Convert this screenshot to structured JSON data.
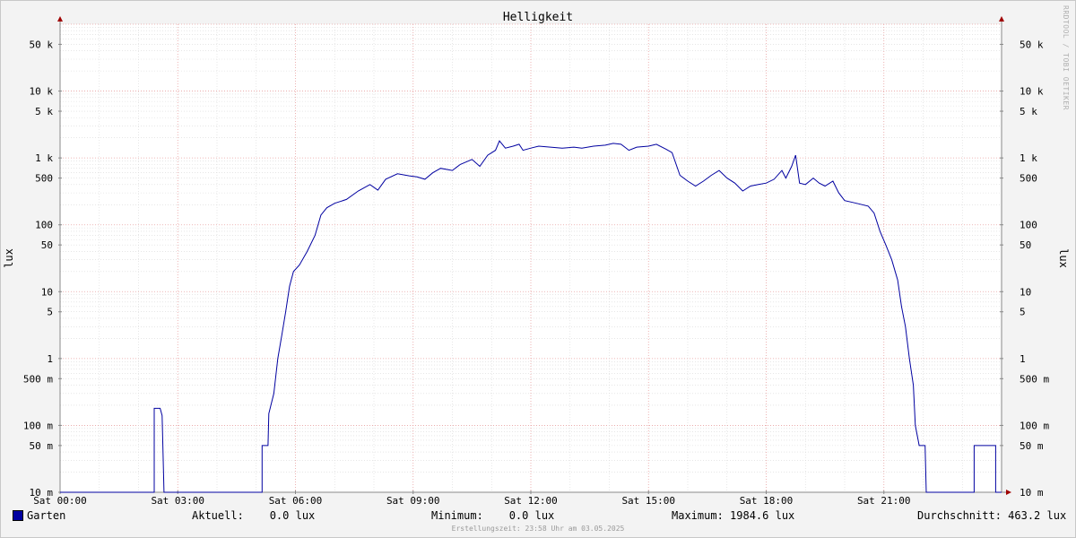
{
  "watermark": "RRDTOOL / TOBI OETIKER",
  "chart_data": {
    "type": "line",
    "title": "Helligkeit",
    "ylabel": "lux",
    "yscale": "log",
    "ylim": [
      0.01,
      100000
    ],
    "xlim_hours": [
      0,
      24
    ],
    "grid": true,
    "x_ticks": [
      {
        "hour": 0,
        "label": "Sat 00:00"
      },
      {
        "hour": 3,
        "label": "Sat 03:00"
      },
      {
        "hour": 6,
        "label": "Sat 06:00"
      },
      {
        "hour": 9,
        "label": "Sat 09:00"
      },
      {
        "hour": 12,
        "label": "Sat 12:00"
      },
      {
        "hour": 15,
        "label": "Sat 15:00"
      },
      {
        "hour": 18,
        "label": "Sat 18:00"
      },
      {
        "hour": 21,
        "label": "Sat 21:00"
      }
    ],
    "y_ticks": [
      {
        "value": 0.01,
        "label": "10 m"
      },
      {
        "value": 0.05,
        "label": "50 m"
      },
      {
        "value": 0.1,
        "label": "100 m"
      },
      {
        "value": 0.5,
        "label": "500 m"
      },
      {
        "value": 1,
        "label": "1"
      },
      {
        "value": 5,
        "label": "5"
      },
      {
        "value": 10,
        "label": "10"
      },
      {
        "value": 50,
        "label": "50"
      },
      {
        "value": 100,
        "label": "100"
      },
      {
        "value": 500,
        "label": "500"
      },
      {
        "value": 1000,
        "label": "1 k"
      },
      {
        "value": 5000,
        "label": "5 k"
      },
      {
        "value": 10000,
        "label": "10 k"
      },
      {
        "value": 50000,
        "label": "50 k"
      }
    ],
    "series": [
      {
        "name": "Garten",
        "color": "#0000a0",
        "points": [
          [
            0.0,
            0.01
          ],
          [
            2.4,
            0.01
          ],
          [
            2.4,
            0.18
          ],
          [
            2.55,
            0.18
          ],
          [
            2.6,
            0.14
          ],
          [
            2.65,
            0.01
          ],
          [
            5.15,
            0.01
          ],
          [
            5.15,
            0.05
          ],
          [
            5.3,
            0.05
          ],
          [
            5.32,
            0.15
          ],
          [
            5.45,
            0.3
          ],
          [
            5.55,
            1.0
          ],
          [
            5.65,
            2.2
          ],
          [
            5.75,
            5.0
          ],
          [
            5.85,
            12
          ],
          [
            5.95,
            20
          ],
          [
            6.1,
            25
          ],
          [
            6.3,
            40
          ],
          [
            6.5,
            70
          ],
          [
            6.65,
            140
          ],
          [
            6.8,
            180
          ],
          [
            7.0,
            210
          ],
          [
            7.3,
            240
          ],
          [
            7.6,
            320
          ],
          [
            7.9,
            400
          ],
          [
            8.1,
            330
          ],
          [
            8.3,
            480
          ],
          [
            8.6,
            580
          ],
          [
            8.9,
            540
          ],
          [
            9.1,
            520
          ],
          [
            9.3,
            480
          ],
          [
            9.5,
            600
          ],
          [
            9.7,
            700
          ],
          [
            10.0,
            650
          ],
          [
            10.2,
            800
          ],
          [
            10.5,
            950
          ],
          [
            10.7,
            750
          ],
          [
            10.9,
            1100
          ],
          [
            11.1,
            1300
          ],
          [
            11.2,
            1800
          ],
          [
            11.35,
            1400
          ],
          [
            11.55,
            1500
          ],
          [
            11.7,
            1600
          ],
          [
            11.8,
            1300
          ],
          [
            12.0,
            1400
          ],
          [
            12.2,
            1500
          ],
          [
            12.5,
            1450
          ],
          [
            12.8,
            1400
          ],
          [
            13.1,
            1450
          ],
          [
            13.3,
            1400
          ],
          [
            13.6,
            1500
          ],
          [
            13.9,
            1550
          ],
          [
            14.1,
            1650
          ],
          [
            14.3,
            1600
          ],
          [
            14.5,
            1300
          ],
          [
            14.7,
            1450
          ],
          [
            15.0,
            1500
          ],
          [
            15.2,
            1600
          ],
          [
            15.45,
            1350
          ],
          [
            15.6,
            1200
          ],
          [
            15.8,
            550
          ],
          [
            16.0,
            450
          ],
          [
            16.2,
            380
          ],
          [
            16.4,
            450
          ],
          [
            16.6,
            550
          ],
          [
            16.8,
            650
          ],
          [
            17.0,
            500
          ],
          [
            17.2,
            420
          ],
          [
            17.4,
            320
          ],
          [
            17.6,
            380
          ],
          [
            17.8,
            400
          ],
          [
            18.0,
            420
          ],
          [
            18.2,
            480
          ],
          [
            18.4,
            650
          ],
          [
            18.5,
            500
          ],
          [
            18.65,
            750
          ],
          [
            18.75,
            1100
          ],
          [
            18.85,
            420
          ],
          [
            19.0,
            400
          ],
          [
            19.2,
            500
          ],
          [
            19.35,
            420
          ],
          [
            19.5,
            380
          ],
          [
            19.7,
            450
          ],
          [
            19.85,
            300
          ],
          [
            20.0,
            230
          ],
          [
            20.3,
            210
          ],
          [
            20.6,
            190
          ],
          [
            20.75,
            150
          ],
          [
            20.9,
            80
          ],
          [
            21.05,
            50
          ],
          [
            21.2,
            30
          ],
          [
            21.35,
            15
          ],
          [
            21.45,
            6
          ],
          [
            21.55,
            3
          ],
          [
            21.65,
            1.0
          ],
          [
            21.75,
            0.4
          ],
          [
            21.8,
            0.1
          ],
          [
            21.9,
            0.05
          ],
          [
            22.05,
            0.05
          ],
          [
            22.08,
            0.01
          ],
          [
            23.3,
            0.01
          ],
          [
            23.3,
            0.05
          ],
          [
            23.85,
            0.05
          ],
          [
            23.85,
            0.01
          ],
          [
            24.0,
            0.01
          ]
        ]
      }
    ],
    "legend": {
      "series_label": "Garten",
      "aktuell": "Aktuell:    0.0 lux",
      "minimum": "Minimum:    0.0 lux",
      "maximum": "Maximum: 1984.6 lux",
      "durchschnitt": "Durchschnitt: 463.2 lux"
    },
    "footer": "Erstellungszeit: 23:58 Uhr am 03.05.2025"
  }
}
